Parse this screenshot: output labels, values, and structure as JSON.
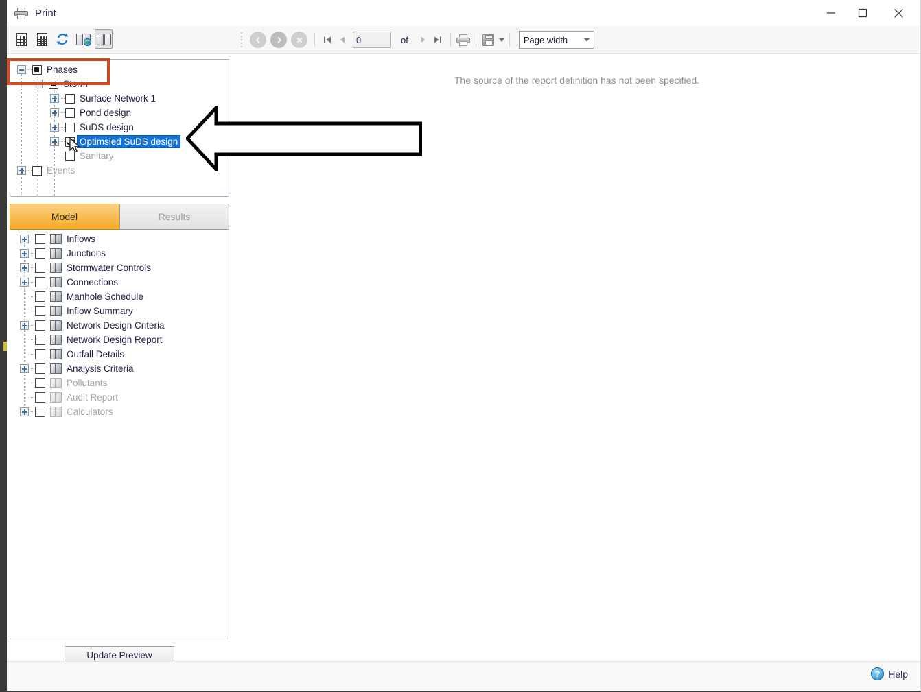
{
  "window": {
    "title": "Print",
    "icon": "printer-icon",
    "controls": {
      "minimize": "minimize-icon",
      "maximize": "maximize-icon",
      "close": "close-icon"
    }
  },
  "toolbar": {
    "buttons": [
      {
        "name": "report-table-icon",
        "pressed": false
      },
      {
        "name": "report-grid-icon",
        "pressed": false
      },
      {
        "name": "refresh-icon",
        "pressed": false
      },
      {
        "name": "book-globe-icon",
        "pressed": false
      },
      {
        "name": "book-icon",
        "pressed": true
      }
    ]
  },
  "preview_toolbar": {
    "back_icon": "back-circle-icon",
    "forward_icon": "forward-circle-icon",
    "stop_icon": "stop-circle-icon",
    "first_page_icon": "first-page-icon",
    "prev_page_icon": "previous-page-icon",
    "page_value": "0",
    "of_label": "of",
    "next_page_icon": "next-page-icon",
    "last_page_icon": "last-page-icon",
    "print_icon": "print-icon",
    "save_icon": "save-icon",
    "save_caret_icon": "chevron-down-icon",
    "zoom_value": "Page width",
    "zoom_caret_icon": "chevron-down-icon"
  },
  "preview": {
    "message": "The source of the report definition has not been specified."
  },
  "phases_tree": {
    "nodes": [
      {
        "label": "Phases",
        "indent": 0,
        "expander": "minus",
        "check": "square",
        "state": "normal",
        "selected": false
      },
      {
        "label": "Storm",
        "indent": 1,
        "expander": "minus",
        "check": "square",
        "state": "normal",
        "selected": false
      },
      {
        "label": "Surface Network 1",
        "indent": 2,
        "expander": "plus",
        "check": "empty",
        "state": "normal",
        "selected": false
      },
      {
        "label": "Pond design",
        "indent": 2,
        "expander": "plus",
        "check": "empty",
        "state": "normal",
        "selected": false
      },
      {
        "label": "SuDS design",
        "indent": 2,
        "expander": "plus",
        "check": "empty",
        "state": "normal",
        "selected": false
      },
      {
        "label": "Optimsied SuDS design",
        "indent": 2,
        "expander": "plus",
        "check": "checked",
        "state": "normal",
        "selected": true
      },
      {
        "label": "Sanitary",
        "indent": 2,
        "expander": "none",
        "check": "empty",
        "state": "disabled",
        "selected": false
      },
      {
        "label": "Events",
        "indent": 0,
        "expander": "plus",
        "check": "empty",
        "state": "disabled",
        "selected": false
      }
    ]
  },
  "tabs": [
    {
      "label": "Model",
      "active": true
    },
    {
      "label": "Results",
      "active": false
    }
  ],
  "model_tree": {
    "items": [
      {
        "label": "Inflows",
        "expander": true,
        "state": "normal"
      },
      {
        "label": "Junctions",
        "expander": true,
        "state": "normal"
      },
      {
        "label": "Stormwater Controls",
        "expander": true,
        "state": "normal"
      },
      {
        "label": "Connections",
        "expander": true,
        "state": "normal"
      },
      {
        "label": "Manhole Schedule",
        "expander": false,
        "state": "normal"
      },
      {
        "label": "Inflow Summary",
        "expander": false,
        "state": "normal"
      },
      {
        "label": "Network Design Criteria",
        "expander": true,
        "state": "normal"
      },
      {
        "label": "Network Design Report",
        "expander": false,
        "state": "normal"
      },
      {
        "label": "Outfall Details",
        "expander": false,
        "state": "normal"
      },
      {
        "label": "Analysis Criteria",
        "expander": true,
        "state": "normal"
      },
      {
        "label": "Pollutants",
        "expander": false,
        "state": "disabled"
      },
      {
        "label": "Audit Report",
        "expander": false,
        "state": "disabled"
      },
      {
        "label": "Calculators",
        "expander": true,
        "state": "disabled"
      }
    ]
  },
  "update_button": {
    "label": "Update Preview"
  },
  "help": {
    "label": "Help",
    "icon": "help-icon"
  },
  "annotations": {
    "highlight_box_color": "#cf4a22",
    "arrow_direction": "left",
    "arrow_color": "#000000",
    "selection_color": "#1572d3"
  }
}
